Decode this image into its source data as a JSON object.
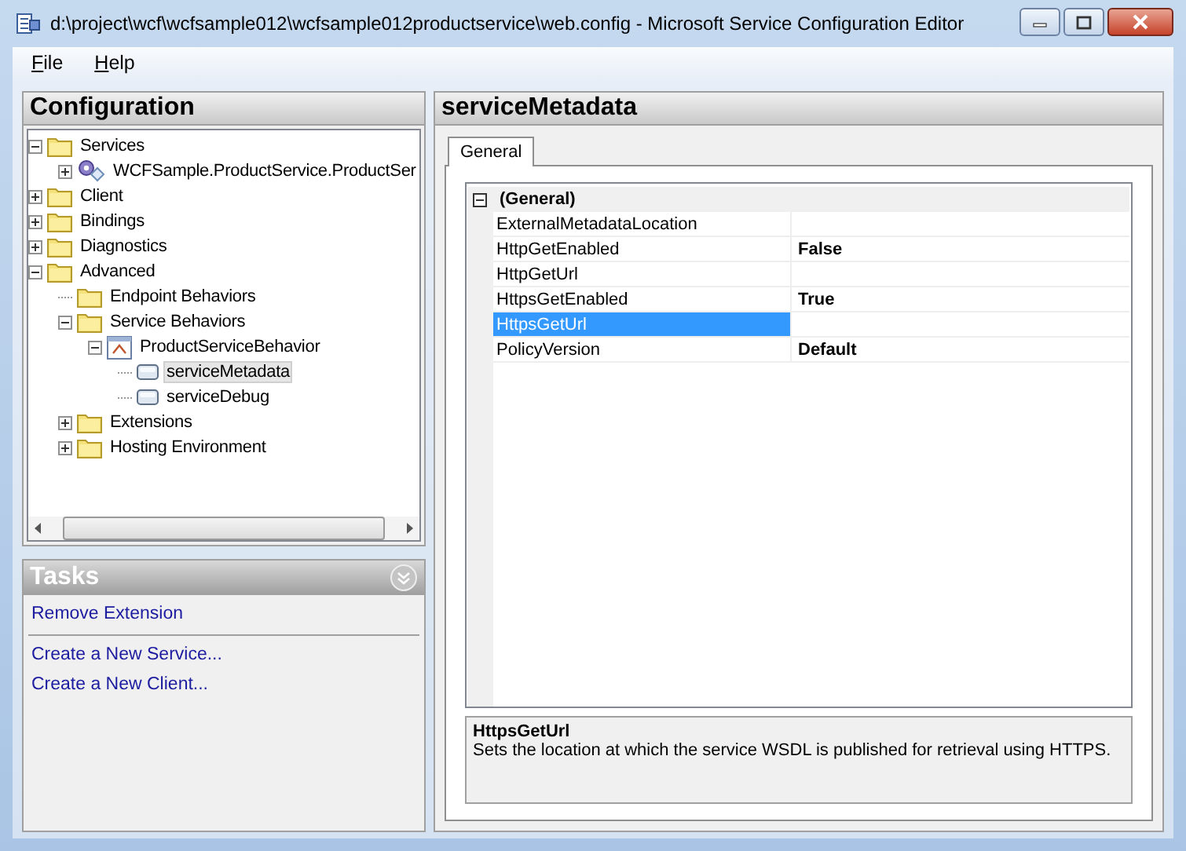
{
  "window": {
    "title": "d:\\project\\wcf\\wcfsample012\\wcfsample012productservice\\web.config - Microsoft Service Configuration Editor"
  },
  "menu": [
    {
      "label": "File"
    },
    {
      "label": "Help"
    }
  ],
  "configuration": {
    "title": "Configuration",
    "tree": [
      {
        "label": "Services",
        "kind": "folder",
        "expanded": true,
        "selected": false,
        "children": [
          {
            "label": "WCFSample.ProductService.ProductSer",
            "kind": "service",
            "expanded": false,
            "selected": false
          }
        ]
      },
      {
        "label": "Client",
        "kind": "folder",
        "expanded": false,
        "selected": false
      },
      {
        "label": "Bindings",
        "kind": "folder",
        "expanded": false,
        "selected": false
      },
      {
        "label": "Diagnostics",
        "kind": "folder",
        "expanded": false,
        "selected": false
      },
      {
        "label": "Advanced",
        "kind": "folder",
        "expanded": true,
        "selected": false,
        "children": [
          {
            "label": "Endpoint Behaviors",
            "kind": "folder",
            "selected": false
          },
          {
            "label": "Service Behaviors",
            "kind": "folder",
            "expanded": true,
            "selected": false,
            "children": [
              {
                "label": "ProductServiceBehavior",
                "kind": "behavior",
                "expanded": true,
                "selected": false,
                "children": [
                  {
                    "label": "serviceMetadata",
                    "kind": "extension",
                    "selected": true
                  },
                  {
                    "label": "serviceDebug",
                    "kind": "extension",
                    "selected": false
                  }
                ]
              }
            ]
          },
          {
            "label": "Extensions",
            "kind": "folder",
            "expanded": false,
            "selected": false
          },
          {
            "label": "Hosting Environment",
            "kind": "folder",
            "expanded": false,
            "selected": false
          }
        ]
      }
    ]
  },
  "tasks": {
    "title": "Tasks",
    "groups": [
      {
        "links": [
          "Remove Extension"
        ]
      },
      {
        "links": [
          "Create a New Service...",
          "Create a New Client..."
        ]
      }
    ]
  },
  "editor": {
    "title": "serviceMetadata",
    "tabs": [
      {
        "label": "General",
        "selected": true
      }
    ],
    "property_grid": {
      "categories": [
        {
          "label": "(General)",
          "expanded": true,
          "properties": [
            {
              "name": "ExternalMetadataLocation",
              "selected": false
            },
            {
              "name": "HttpGetEnabled",
              "value": "False",
              "selected": false
            },
            {
              "name": "HttpGetUrl",
              "selected": false
            },
            {
              "name": "HttpsGetEnabled",
              "value": "True",
              "selected": false
            },
            {
              "name": "HttpsGetUrl",
              "selected": true
            },
            {
              "name": "PolicyVersion",
              "value": "Default",
              "selected": false
            }
          ]
        }
      ]
    },
    "description": {
      "title": "HttpsGetUrl",
      "text": "Sets the location at which the service WSDL is published for retrieval using HTTPS."
    }
  }
}
